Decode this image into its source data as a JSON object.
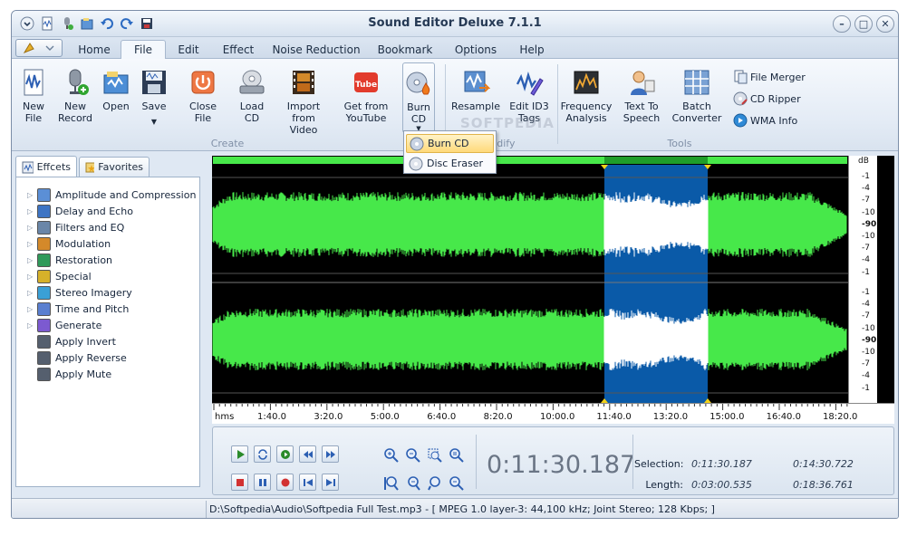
{
  "window": {
    "title": "Sound Editor Deluxe 7.1.1"
  },
  "ribbon_tabs": [
    {
      "label": "Home"
    },
    {
      "label": "File",
      "active": true
    },
    {
      "label": "Edit"
    },
    {
      "label": "Effect"
    },
    {
      "label": "Noise Reduction"
    },
    {
      "label": "Bookmark"
    },
    {
      "label": "Options"
    },
    {
      "label": "Help"
    }
  ],
  "ribbon": {
    "new_file": "New\nFile",
    "new_record": "New\nRecord",
    "open": "Open",
    "save": "Save",
    "close_file": "Close\nFile",
    "load_cd": "Load\nCD",
    "import_video": "Import from\nVideo",
    "youtube": "Get from\nYouTube",
    "burn_cd": "Burn\nCD",
    "resample": "Resample",
    "edit_id3": "Edit ID3\nTags",
    "frequency": "Frequency\nAnalysis",
    "tts": "Text To\nSpeech",
    "batch": "Batch\nConverter",
    "file_merger": "File Merger",
    "cd_ripper": "CD Ripper",
    "wma_info": "WMA Info",
    "group_create": "Create",
    "group_modify": "odify",
    "group_tools": "Tools",
    "youtube_logo": "Tube"
  },
  "burn_menu": {
    "burn_cd": "Burn CD",
    "disc_eraser": "Disc Eraser"
  },
  "watermark": "SOFTPEDIA",
  "panel_tabs": {
    "effects": "Effcets",
    "favorites": "Favorites"
  },
  "effects": [
    {
      "label": "Amplitude and Compression",
      "expandable": true
    },
    {
      "label": "Delay and Echo",
      "expandable": true
    },
    {
      "label": "Filters and EQ",
      "expandable": true
    },
    {
      "label": "Modulation",
      "expandable": true
    },
    {
      "label": "Restoration",
      "expandable": true
    },
    {
      "label": "Special",
      "expandable": true
    },
    {
      "label": "Stereo Imagery",
      "expandable": true
    },
    {
      "label": "Time and Pitch",
      "expandable": true
    },
    {
      "label": "Generate",
      "expandable": true
    },
    {
      "label": "Apply Invert",
      "expandable": false
    },
    {
      "label": "Apply Reverse",
      "expandable": false
    },
    {
      "label": "Apply Mute",
      "expandable": false
    }
  ],
  "db_scale": {
    "unit": "dB",
    "ch1": [
      "-1",
      "-4",
      "-7",
      "-10",
      "-90",
      "-10",
      "-7",
      "-4",
      "-1"
    ],
    "ch2": [
      "-1",
      "-4",
      "-7",
      "-10",
      "-90",
      "-10",
      "-7",
      "-4",
      "-1"
    ]
  },
  "timeline": {
    "unit": "hms",
    "ticks": [
      "1:40.0",
      "3:20.0",
      "5:00.0",
      "6:40.0",
      "8:20.0",
      "10:00.0",
      "11:40.0",
      "13:20.0",
      "15:00.0",
      "16:40.0",
      "18:20.0"
    ]
  },
  "transport": {
    "current_time": "0:11:30.187",
    "selection_label": "Selection:",
    "selection_start": "0:11:30.187",
    "selection_end": "0:14:30.722",
    "length_label": "Length:",
    "length_selection": "0:03:00.535",
    "length_total": "0:18:36.761"
  },
  "status": {
    "text": "D:\\Softpedia\\Audio\\Softpedia Full Test.mp3 - [ MPEG 1.0 layer-3: 44,100 kHz; Joint Stereo; 128 Kbps; ]"
  },
  "colors": {
    "waveform": "#47e84a",
    "selection": "#0a5aa8",
    "selected_wave": "#ffffff"
  }
}
